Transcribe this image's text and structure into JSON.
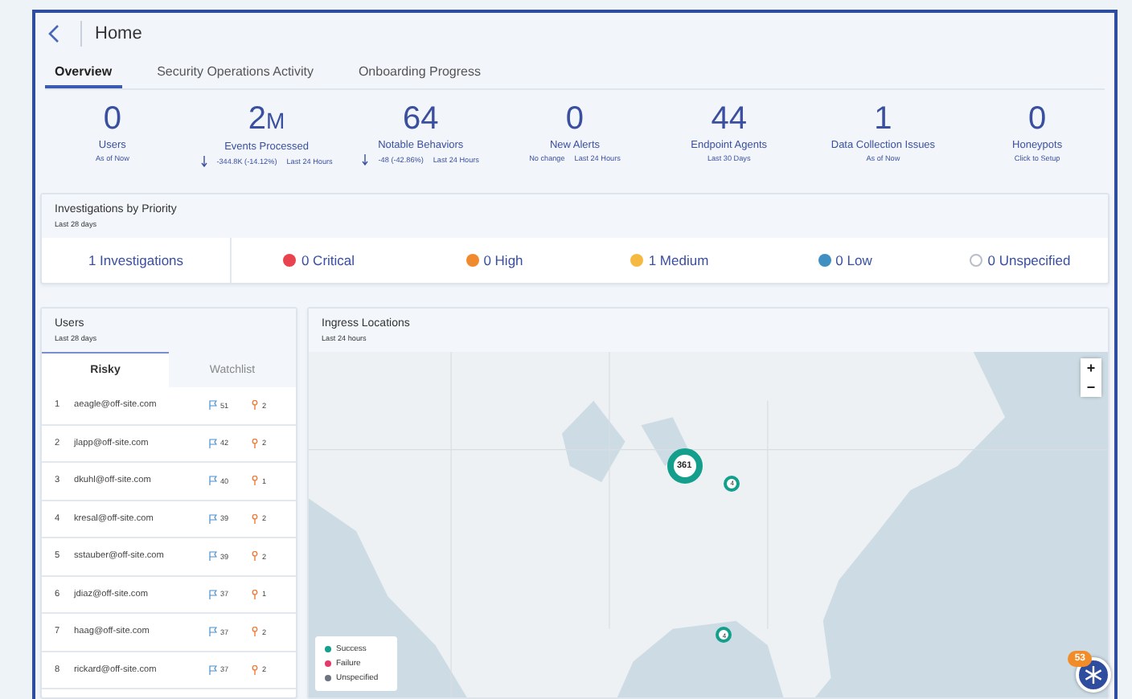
{
  "header": {
    "title": "Home"
  },
  "tabs": [
    {
      "label": "Overview",
      "selected": true
    },
    {
      "label": "Security Operations Activity",
      "selected": false
    },
    {
      "label": "Onboarding Progress",
      "selected": false
    }
  ],
  "stats": [
    {
      "kind": "plain",
      "value": "0",
      "label": "Users",
      "note": "As of Now"
    },
    {
      "kind": "decrease",
      "value": "2",
      "unit": "M",
      "label": "Events Processed",
      "change": "-344.8K (-14.12%)",
      "note": "Last 24 Hours"
    },
    {
      "kind": "decrease",
      "value": "64",
      "label": "Notable Behaviors",
      "change": "-48 (-42.86%)",
      "note": "Last 24 Hours"
    },
    {
      "kind": "plain",
      "value": "0",
      "label": "New Alerts",
      "change": "No change",
      "note": "Last 24 Hours"
    },
    {
      "kind": "plain",
      "value": "44",
      "label": "Endpoint Agents",
      "note": "Last 30 Days"
    },
    {
      "kind": "plain",
      "value": "1",
      "label": "Data Collection Issues",
      "note": "As of Now"
    },
    {
      "kind": "plain",
      "value": "0",
      "label": "Honeypots",
      "note": "Click to Setup"
    }
  ],
  "investigations": {
    "title": "Investigations by Priority",
    "subtitle": "Last 28 days",
    "total": "1 Investigations",
    "priorities": [
      {
        "kind": "critical",
        "label": "0 Critical",
        "color": "#e8434f"
      },
      {
        "kind": "high",
        "label": "0 High",
        "color": "#f08a2c"
      },
      {
        "kind": "medium",
        "label": "1 Medium",
        "color": "#f5b942"
      },
      {
        "kind": "low",
        "label": "0 Low",
        "color": "#3f8fc0"
      },
      {
        "kind": "unspecified",
        "label": "0 Unspecified",
        "color": "#b8bec6"
      }
    ]
  },
  "users": {
    "title": "Users",
    "subtitle": "Last 28 days",
    "tabs": [
      {
        "label": "Risky",
        "selected": true
      },
      {
        "label": "Watchlist",
        "selected": false
      }
    ],
    "rows": [
      {
        "rank": "1",
        "email": "aeagle@off-site.com",
        "flags": "51",
        "alerts": "2"
      },
      {
        "rank": "2",
        "email": "jlapp@off-site.com",
        "flags": "42",
        "alerts": "2"
      },
      {
        "rank": "3",
        "email": "dkuhl@off-site.com",
        "flags": "40",
        "alerts": "1"
      },
      {
        "rank": "4",
        "email": "kresal@off-site.com",
        "flags": "39",
        "alerts": "2"
      },
      {
        "rank": "5",
        "email": "sstauber@off-site.com",
        "flags": "39",
        "alerts": "2"
      },
      {
        "rank": "6",
        "email": "jdiaz@off-site.com",
        "flags": "37",
        "alerts": "1"
      },
      {
        "rank": "7",
        "email": "haag@off-site.com",
        "flags": "37",
        "alerts": "2"
      },
      {
        "rank": "8",
        "email": "rickard@off-site.com",
        "flags": "37",
        "alerts": "2"
      }
    ]
  },
  "ingress": {
    "title": "Ingress Locations",
    "subtitle": "Last 24 hours",
    "zoom": [
      "+",
      "−"
    ],
    "markers": [
      {
        "kind": "cluster",
        "count": "361"
      },
      {
        "kind": "point",
        "count": "4"
      },
      {
        "kind": "point",
        "count": "4"
      }
    ],
    "legend": [
      {
        "label": "Success",
        "color": "#149e8c"
      },
      {
        "label": "Failure",
        "color": "#e23a6a"
      },
      {
        "label": "Unspecified",
        "color": "#6b7480"
      }
    ]
  },
  "launcher": {
    "badge": "53"
  }
}
